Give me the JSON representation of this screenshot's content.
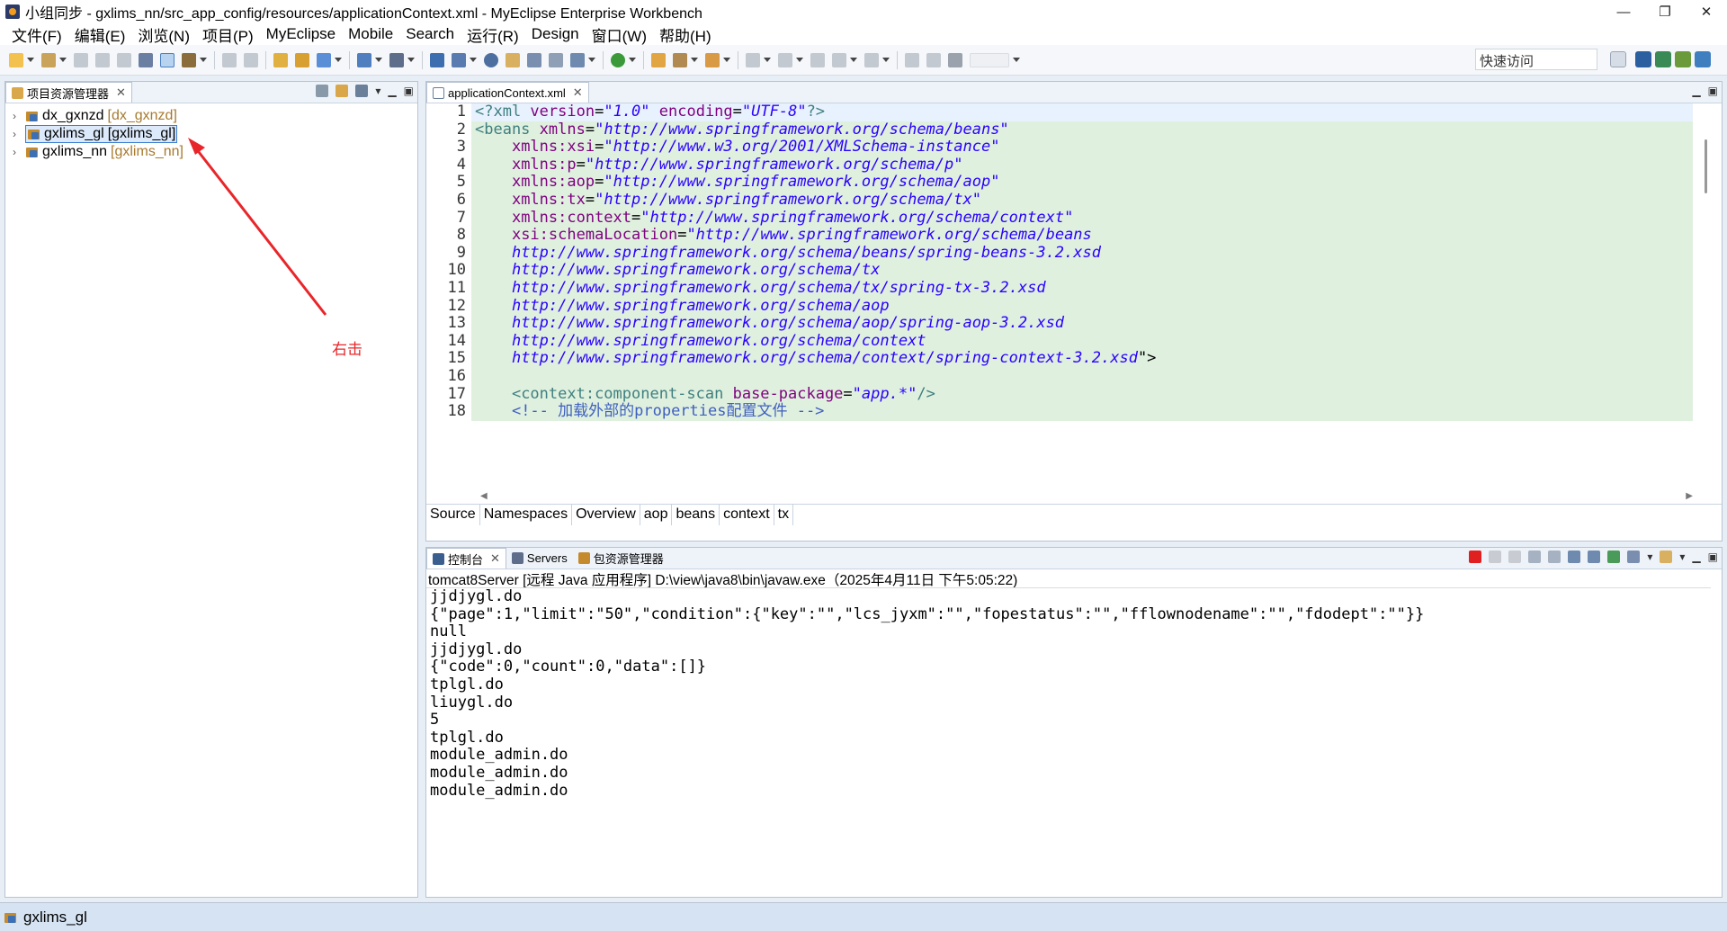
{
  "window": {
    "title": "小组同步 - gxlims_nn/src_app_config/resources/applicationContext.xml - MyEclipse Enterprise Workbench",
    "min": "—",
    "max": "❐",
    "close": "✕"
  },
  "menu": [
    "文件(F)",
    "编辑(E)",
    "浏览(N)",
    "项目(P)",
    "MyEclipse",
    "Mobile",
    "Search",
    "运行(R)",
    "Design",
    "窗口(W)",
    "帮助(H)"
  ],
  "toolbar": {
    "quick_access": "快速访问"
  },
  "explorer": {
    "tab": "项目资源管理器",
    "close": "✕",
    "items": [
      {
        "name": "dx_gxnzd",
        "deco": "[dx_gxnzd]"
      },
      {
        "name": "gxlims_gl",
        "deco": "[gxlims_gl]"
      },
      {
        "name": "gxlims_nn",
        "deco": "[gxlims_nn]"
      }
    ]
  },
  "editor": {
    "tab": "applicationContext.xml",
    "close": "✕",
    "lines": [
      {
        "n": "1",
        "parts": [
          [
            "t-tag",
            "<?xml "
          ],
          [
            "t-attr",
            "version"
          ],
          [
            "t-plain",
            "="
          ],
          [
            "t-str",
            "\"1.0\""
          ],
          [
            "t-plain",
            " "
          ],
          [
            "t-attr",
            "encoding"
          ],
          [
            "t-plain",
            "="
          ],
          [
            "t-str",
            "\"UTF-8\""
          ],
          [
            "t-tag",
            "?>"
          ]
        ]
      },
      {
        "n": "2",
        "parts": [
          [
            "t-tag",
            "<beans "
          ],
          [
            "t-attr",
            "xmlns"
          ],
          [
            "t-plain",
            "="
          ],
          [
            "t-str",
            "\"http://www.springframework.org/schema/beans\""
          ]
        ]
      },
      {
        "n": "3",
        "parts": [
          [
            "t-plain",
            "    "
          ],
          [
            "t-attr",
            "xmlns:xsi"
          ],
          [
            "t-plain",
            "="
          ],
          [
            "t-str",
            "\"http://www.w3.org/2001/XMLSchema-instance\""
          ]
        ]
      },
      {
        "n": "4",
        "parts": [
          [
            "t-plain",
            "    "
          ],
          [
            "t-attr",
            "xmlns:p"
          ],
          [
            "t-plain",
            "="
          ],
          [
            "t-str",
            "\"http://www.springframework.org/schema/p\""
          ]
        ]
      },
      {
        "n": "5",
        "parts": [
          [
            "t-plain",
            "    "
          ],
          [
            "t-attr",
            "xmlns:aop"
          ],
          [
            "t-plain",
            "="
          ],
          [
            "t-str",
            "\"http://www.springframework.org/schema/aop\""
          ]
        ]
      },
      {
        "n": "6",
        "parts": [
          [
            "t-plain",
            "    "
          ],
          [
            "t-attr",
            "xmlns:tx"
          ],
          [
            "t-plain",
            "="
          ],
          [
            "t-str",
            "\"http://www.springframework.org/schema/tx\""
          ]
        ]
      },
      {
        "n": "7",
        "parts": [
          [
            "t-plain",
            "    "
          ],
          [
            "t-attr",
            "xmlns:context"
          ],
          [
            "t-plain",
            "="
          ],
          [
            "t-str",
            "\"http://www.springframework.org/schema/context\""
          ]
        ]
      },
      {
        "n": "8",
        "parts": [
          [
            "t-plain",
            "    "
          ],
          [
            "t-attr",
            "xsi:schemaLocation"
          ],
          [
            "t-plain",
            "="
          ],
          [
            "t-str",
            "\"http://www.springframework.org/schema/beans"
          ]
        ]
      },
      {
        "n": "9",
        "parts": [
          [
            "t-plain",
            "    "
          ],
          [
            "t-str",
            "http://www.springframework.org/schema/beans/spring-beans-3.2.xsd"
          ]
        ]
      },
      {
        "n": "10",
        "parts": [
          [
            "t-plain",
            "    "
          ],
          [
            "t-str",
            "http://www.springframework.org/schema/tx"
          ]
        ]
      },
      {
        "n": "11",
        "parts": [
          [
            "t-plain",
            "    "
          ],
          [
            "t-str",
            "http://www.springframework.org/schema/tx/spring-tx-3.2.xsd"
          ]
        ]
      },
      {
        "n": "12",
        "parts": [
          [
            "t-plain",
            "    "
          ],
          [
            "t-str",
            "http://www.springframework.org/schema/aop"
          ]
        ]
      },
      {
        "n": "13",
        "parts": [
          [
            "t-plain",
            "    "
          ],
          [
            "t-str",
            "http://www.springframework.org/schema/aop/spring-aop-3.2.xsd"
          ]
        ]
      },
      {
        "n": "14",
        "parts": [
          [
            "t-plain",
            "    "
          ],
          [
            "t-str",
            "http://www.springframework.org/schema/context"
          ]
        ]
      },
      {
        "n": "15",
        "parts": [
          [
            "t-plain",
            "    "
          ],
          [
            "t-str",
            "http://www.springframework.org/schema/context/spring-context-3.2.xsd"
          ],
          [
            "t-plain",
            "\">"
          ]
        ]
      },
      {
        "n": "16",
        "parts": [
          [
            "t-plain",
            ""
          ]
        ]
      },
      {
        "n": "17",
        "parts": [
          [
            "t-plain",
            "    "
          ],
          [
            "t-tag",
            "<context:component-scan "
          ],
          [
            "t-attr",
            "base-package"
          ],
          [
            "t-plain",
            "="
          ],
          [
            "t-str",
            "\"app.*\""
          ],
          [
            "t-tag",
            "/>"
          ]
        ]
      },
      {
        "n": "18",
        "parts": [
          [
            "t-plain",
            "    "
          ],
          [
            "t-com",
            "<!-- 加载外部的properties配置文件 -->"
          ]
        ]
      }
    ],
    "bottom_tabs": [
      "Source",
      "Namespaces",
      "Overview",
      "aop",
      "beans",
      "context",
      "tx"
    ]
  },
  "console": {
    "tabs": [
      "控制台",
      "Servers",
      "包资源管理器"
    ],
    "close": "✕",
    "header": "tomcat8Server [远程 Java 应用程序] D:\\view\\java8\\bin\\javaw.exe（2025年4月11日 下午5:05:22)",
    "lines": [
      "jjdjygl.do",
      "{\"page\":1,\"limit\":\"50\",\"condition\":{\"key\":\"\",\"lcs_jyxm\":\"\",\"fopestatus\":\"\",\"fflownodename\":\"\",\"fdodept\":\"\"}}",
      "null",
      "jjdjygl.do",
      "{\"code\":0,\"count\":0,\"data\":[]}",
      "tplgl.do",
      "liuygl.do",
      "5",
      "tplgl.do",
      "module_admin.do",
      "module_admin.do",
      "module_admin.do"
    ]
  },
  "status": {
    "text": "gxlims_gl"
  },
  "annotation": {
    "text": "右击",
    "color": "#e8262a"
  }
}
